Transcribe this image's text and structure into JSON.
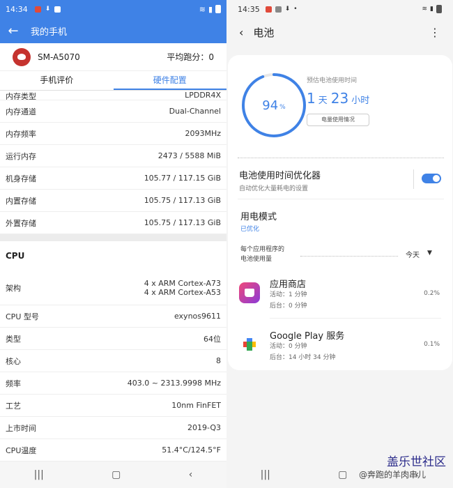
{
  "left": {
    "status": {
      "time": "14:34"
    },
    "appbar": {
      "title": "我的手机"
    },
    "device": {
      "name": "SM-A5070",
      "score": "平均跑分：0"
    },
    "tabs": [
      "手机评价",
      "硬件配置"
    ],
    "memory_rows": [
      {
        "label": "内存类型",
        "value": "LPDDR4X"
      },
      {
        "label": "内存通道",
        "value": "Dual-Channel"
      },
      {
        "label": "内存频率",
        "value": "2093MHz"
      },
      {
        "label": "运行内存",
        "value": "2473 / 5588 MiB"
      },
      {
        "label": "机身存储",
        "value": "105.77 / 117.15 GiB"
      },
      {
        "label": "内置存储",
        "value": "105.75 / 117.13 GiB"
      },
      {
        "label": "外置存储",
        "value": "105.75 / 117.13 GiB"
      }
    ],
    "cpu_section": "CPU",
    "cpu_arch": {
      "label": "架构",
      "line1": "4 x ARM Cortex-A73",
      "line2": "4 x ARM Cortex-A53"
    },
    "cpu_rows": [
      {
        "label": "CPU 型号",
        "value": "exynos9611"
      },
      {
        "label": "类型",
        "value": "64位"
      },
      {
        "label": "核心",
        "value": "8"
      },
      {
        "label": "频率",
        "value": "403.0 ~ 2313.9998 MHz"
      },
      {
        "label": "工艺",
        "value": "10nm FinFET"
      },
      {
        "label": "上市时间",
        "value": "2019-Q3"
      },
      {
        "label": "CPU温度",
        "value": "51.4°C/124.5°F"
      }
    ]
  },
  "right": {
    "status": {
      "time": "14:35"
    },
    "appbar": {
      "title": "电池"
    },
    "battery": {
      "percent": "94",
      "percent_symbol": "%",
      "level_fraction": 0.94,
      "est_label": "预估电池使用时间",
      "days": "1",
      "days_unit": "天",
      "hours": "23",
      "hours_unit": "小时",
      "usage_button": "电量使用情况"
    },
    "optimizer": {
      "title": "电池使用时间优化器",
      "subtitle": "自动优化大量耗电的设置",
      "on": true
    },
    "power_mode": {
      "title": "用电模式",
      "value": "已优化"
    },
    "per_app": {
      "line1": "每个应用程序的",
      "line2": "电池使用量",
      "period": "今天"
    },
    "apps": [
      {
        "name": "应用商店",
        "active": "活动：1 分钟",
        "background": "后台：0 分钟",
        "pct": "0.2%"
      },
      {
        "name": "Google Play 服务",
        "active": "活动：0 分钟",
        "background": "后台：14 小时 34 分钟",
        "pct": "0.1%"
      }
    ],
    "watermark_title": "盖乐世社区",
    "watermark_user": "@奔跑的羊肉串儿"
  },
  "colors": {
    "accent": "#3f82e6",
    "brand_red": "#c5332f"
  },
  "icons": [
    "back-arrow-icon",
    "antutu-logo-icon",
    "more-vert-icon",
    "galaxy-store-icon",
    "google-play-services-icon",
    "recent-apps-icon",
    "home-icon",
    "nav-back-icon"
  ]
}
